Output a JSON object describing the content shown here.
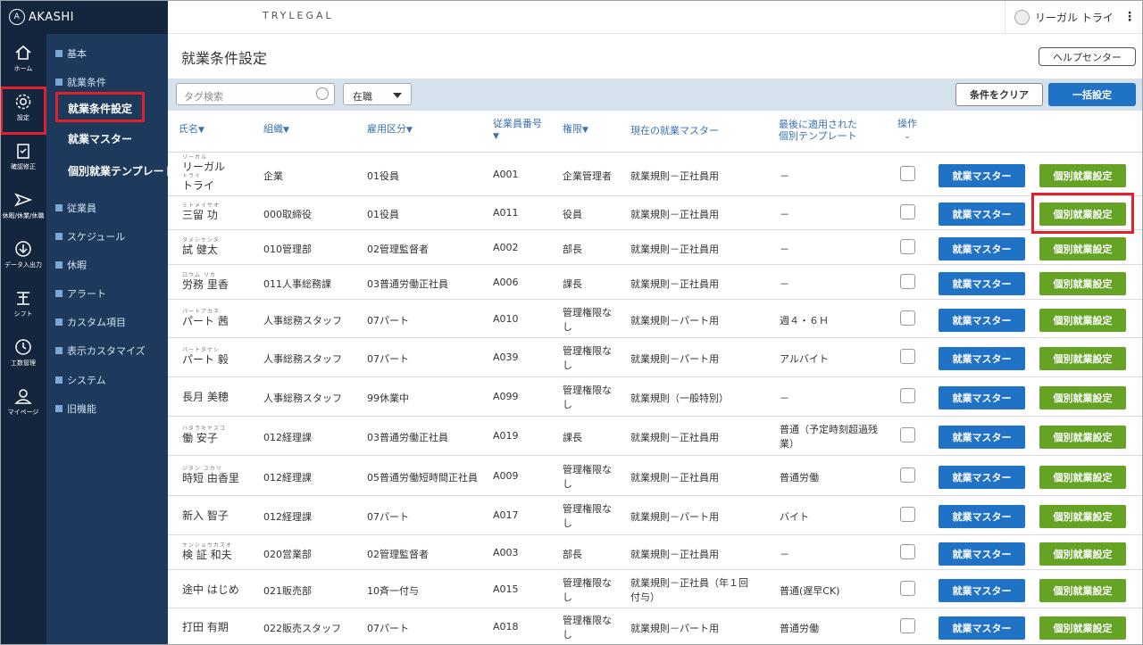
{
  "logo": {
    "text": "AKASHI"
  },
  "header": {
    "brand": "TRYLEGAL",
    "user": "リーガル トライ",
    "more": "⋮"
  },
  "rail": [
    {
      "label": "ホーム",
      "icon": "home-icon"
    },
    {
      "label": "設定",
      "icon": "gear-icon"
    },
    {
      "label": "確認修正",
      "icon": "clipboard-icon"
    },
    {
      "label": "休暇/休業/休職",
      "icon": "plane-icon"
    },
    {
      "label": "データ入出力",
      "icon": "download-icon"
    },
    {
      "label": "シフト",
      "icon": "shift-icon"
    },
    {
      "label": "工数管理",
      "icon": "clock-icon"
    },
    {
      "label": "マイページ",
      "icon": "person-icon"
    }
  ],
  "submenu": {
    "kihon": "基本",
    "shugyo": "就業条件",
    "sub_settings": "就業条件設定",
    "sub_master": "就業マスター",
    "sub_template": "個別就業テンプレート",
    "items": [
      "従業員",
      "スケジュール",
      "休暇",
      "アラート",
      "カスタム項目",
      "表示カスタマイズ",
      "システム",
      "旧機能"
    ]
  },
  "page": {
    "title": "就業条件設定",
    "help": "ヘルプセンター"
  },
  "toolbar": {
    "tag_placeholder": "タグ検索",
    "status": "在職",
    "clear": "条件をクリア",
    "bulk": "一括設定"
  },
  "columns": {
    "name": "氏名",
    "org": "組織",
    "employment": "雇用区分",
    "emp_no_1": "従業員番号",
    "role": "権限",
    "master": "現在の就業マスター",
    "template_1": "最後に適用された",
    "template_2": "個別テンプレート",
    "ops": "操作"
  },
  "buttons": {
    "master": "就業マスター",
    "individual": "個別就業設定"
  },
  "rows": [
    {
      "ruby1": "リーガル",
      "name1": "リーガル",
      "ruby2": "トライ",
      "name2": "トライ",
      "org": "企業",
      "employment": "01役員",
      "no": "A001",
      "role": "企業管理者",
      "master": "就業規則－正社員用",
      "template": "－"
    },
    {
      "ruby1": "ミトメイサオ",
      "name1": "三留 功",
      "org": "000取締役",
      "employment": "01役員",
      "no": "A011",
      "role": "役員",
      "master": "就業規則－正社員用",
      "template": "－"
    },
    {
      "ruby1": "タメシケンタ",
      "name1": "試 健太",
      "org": "010管理部",
      "employment": "02管理監督者",
      "no": "A002",
      "role": "部長",
      "master": "就業規則－正社員用",
      "template": "－"
    },
    {
      "ruby1": "ロウム リカ",
      "name1": "労務 里香",
      "org": "011人事総務課",
      "employment": "03普通労働正社員",
      "no": "A006",
      "role": "課長",
      "master": "就業規則－正社員用",
      "template": "－"
    },
    {
      "ruby1": "パートアカネ",
      "name1": "パート 茜",
      "org": "人事総務スタッフ",
      "employment": "07パート",
      "no": "A010",
      "role": "管理権限なし",
      "master": "就業規則－パート用",
      "template": "週４・６Ｈ"
    },
    {
      "ruby1": "パートタケシ",
      "name1": "パート 毅",
      "org": "人事総務スタッフ",
      "employment": "07パート",
      "no": "A039",
      "role": "管理権限なし",
      "master": "就業規則－パート用",
      "template": "アルバイト"
    },
    {
      "ruby1": "",
      "name1": "長月 美穂",
      "org": "人事総務スタッフ",
      "employment": "99休業中",
      "no": "A099",
      "role": "管理権限なし",
      "master": "就業規則（一般特別）",
      "template": "－"
    },
    {
      "ruby1": "ハタラキヤスコ",
      "name1": "働 安子",
      "org": "012経理課",
      "employment": "03普通労働正社員",
      "no": "A019",
      "role": "課長",
      "master": "就業規則－正社員用",
      "template": "普通（予定時刻超過残業）"
    },
    {
      "ruby1": "ジタン ユカリ",
      "name1": "時短 由香里",
      "org": "012経理課",
      "employment": "05普通労働短時間正社員",
      "no": "A009",
      "role": "管理権限なし",
      "master": "就業規則－正社員用",
      "template": "普通労働"
    },
    {
      "ruby1": "",
      "name1": "新入 智子",
      "org": "012経理課",
      "employment": "07パート",
      "no": "A017",
      "role": "管理権限なし",
      "master": "就業規則－パート用",
      "template": "バイト"
    },
    {
      "ruby1": "ケンショウカズオ",
      "name1": "検 証 和夫",
      "org": "020営業部",
      "employment": "02管理監督者",
      "no": "A003",
      "role": "部長",
      "master": "就業規則－正社員用",
      "template": "－"
    },
    {
      "ruby1": "",
      "name1": "途中 はじめ",
      "org": "021販売部",
      "employment": "10斉一付与",
      "no": "A015",
      "role": "管理権限なし",
      "master": "就業規則－正社員（年１回付与）",
      "template": "普通(遅早CK)"
    },
    {
      "ruby1": "",
      "name1": "打田 有期",
      "org": "022販売スタッフ",
      "employment": "07パート",
      "no": "A018",
      "role": "管理権限なし",
      "master": "就業規則－パート用",
      "template": "普通労働"
    }
  ]
}
